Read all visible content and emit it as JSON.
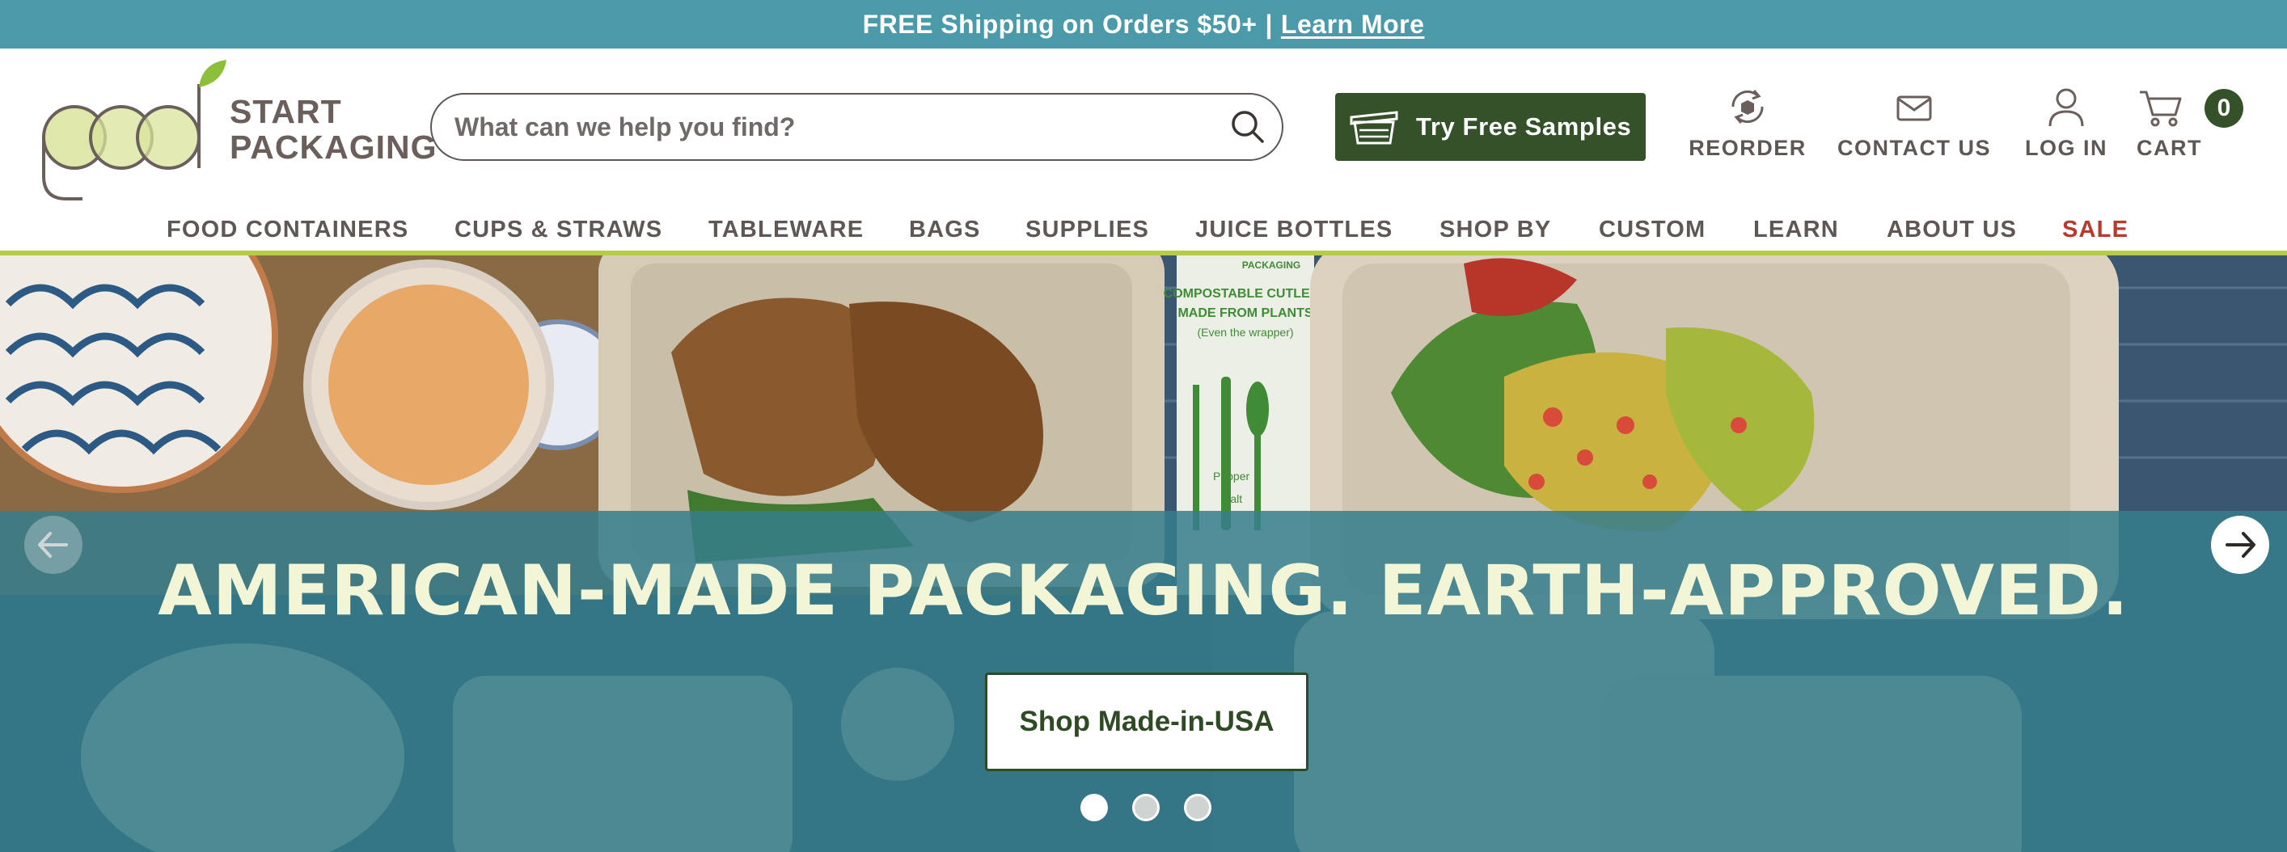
{
  "colors": {
    "announce_bg": "#4a9aaa",
    "brand_green": "#34512a",
    "nav_accent_line": "#b7cc46",
    "sale_red": "#b83a2e",
    "hero_band": "#367e8c",
    "headline_text": "#f3f5d7"
  },
  "announcement": {
    "text": "FREE Shipping on Orders $50+",
    "separator": "|",
    "link": "Learn More"
  },
  "logo": {
    "line1": "START",
    "line2": "PACKAGING",
    "script": "good"
  },
  "search": {
    "placeholder": "What can we help you find?",
    "value": "",
    "icon": "search-icon"
  },
  "samples_button": {
    "label": "Try Free Samples",
    "icon": "box-icon"
  },
  "utility": {
    "reorder": {
      "label": "REORDER",
      "icon": "reorder-icon"
    },
    "contact": {
      "label": "CONTACT US",
      "icon": "envelope-icon"
    },
    "login": {
      "label": "LOG IN",
      "icon": "user-icon"
    },
    "cart": {
      "label": "CART",
      "icon": "cart-icon",
      "count": "0"
    }
  },
  "nav": {
    "items": [
      {
        "label": "FOOD CONTAINERS"
      },
      {
        "label": "CUPS & STRAWS"
      },
      {
        "label": "TABLEWARE"
      },
      {
        "label": "BAGS"
      },
      {
        "label": "SUPPLIES"
      },
      {
        "label": "JUICE BOTTLES"
      },
      {
        "label": "SHOP BY"
      },
      {
        "label": "CUSTOM"
      },
      {
        "label": "LEARN"
      },
      {
        "label": "ABOUT US"
      },
      {
        "label": "SALE"
      }
    ]
  },
  "hero": {
    "headline": "AMERICAN-MADE PACKAGING. EARTH-APPROVED.",
    "cta": "Shop Made-in-USA",
    "slide_count": 3,
    "active_slide": 1,
    "cutlery_wrapper_text": [
      "COMPOSTABLE CUTLERY",
      "MADE FROM PLANTS",
      "(Even the wrapper)"
    ],
    "wrapper_brand": "PACKAGING",
    "packet_labels": [
      "Pepper",
      "Salt"
    ]
  }
}
